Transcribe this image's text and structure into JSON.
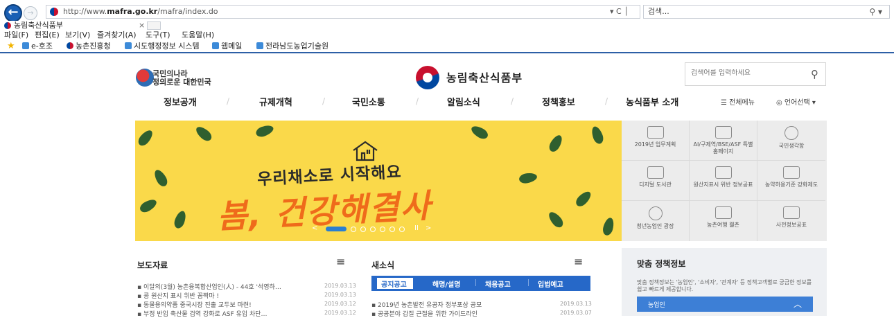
{
  "browser": {
    "back_glyph": "←",
    "forward_glyph": "→",
    "url_prefix": "http://www.",
    "url_domain": "mafra.go.kr",
    "url_path": "/mafra/index.do",
    "url_controls": "▾ C │",
    "search_placeholder": "검색...",
    "search_icon": "⚲ ▾",
    "tab_title": "농림축산식품부",
    "tab_close": "×",
    "menu": [
      "파일(F)",
      "편집(E)",
      "보기(V)",
      "즐겨찾기(A)",
      "도구(T)",
      "도움말(H)"
    ],
    "favorites": [
      "e-호조",
      "농촌진흥청",
      "시도행정정보 시스템",
      "웹메일",
      "전라남도농업기술원"
    ]
  },
  "header": {
    "left_logo_line1": "국민의나라",
    "left_logo_line2": "정의로운 대한민국",
    "ministry": "농림축산식품부",
    "search_placeholder": "검색어를 입력하세요",
    "search_icon_glyph": "⚲"
  },
  "gnb": {
    "items": [
      "정보공개",
      "규제개혁",
      "국민소통",
      "알림소식",
      "정책홍보",
      "농식품부 소개"
    ],
    "all_menu": "☰ 전체메뉴",
    "language": "◎ 언어선택 ▾",
    "sep": "/"
  },
  "banner": {
    "line1": "우리채소로 시작해요",
    "line2": "봄, 건강해결사",
    "dots_prev": "<",
    "dots_pause": "II",
    "dots_next": ">"
  },
  "quick_links": [
    {
      "label": "2019년 업무계획",
      "icon": "chart-icon"
    },
    {
      "label": "AI/구제역/BSE/ASF 특별홈페이지",
      "icon": "monitor-icon"
    },
    {
      "label": "국민생각함",
      "icon": "chat-icon"
    },
    {
      "label": "디지털 도서관",
      "icon": "book-icon"
    },
    {
      "label": "원산지표시 위반 정보공표",
      "icon": "store-icon"
    },
    {
      "label": "농약허용기준 강화제도",
      "icon": "bottle-icon"
    },
    {
      "label": "청년농업인 광장",
      "icon": "satellite-icon"
    },
    {
      "label": "농촌여행 웰촌",
      "icon": "map-icon"
    },
    {
      "label": "사전정보공표",
      "icon": "pen-icon"
    }
  ],
  "press": {
    "title": "보도자료",
    "menu_icon": "≡",
    "items": [
      {
        "text": "이달의(3월) 농촌융복합산업인(人) - 44호 '석영하…",
        "date": "2019.03.13"
      },
      {
        "text": "콩 원산지 표시 위반 꼼짝마 !",
        "date": "2019.03.13"
      },
      {
        "text": "동물용의약품 중국시장 진출 교두보 마련!",
        "date": "2019.03.12"
      },
      {
        "text": "부정 반입 축산물 검역 강화로 ASF 유입 차단…",
        "date": "2019.03.12"
      }
    ]
  },
  "news": {
    "title": "새소식",
    "menu_icon": "≡",
    "tabs": [
      "공지공고",
      "해명/설명",
      "채용공고",
      "입법예고"
    ],
    "items": [
      {
        "text": "2019년 농촌발전 유공자 정부포상 공모",
        "date": "2019.03.13"
      },
      {
        "text": "공공분야 갑질 근절을 위한 가이드라인",
        "date": "2019.03.07"
      }
    ]
  },
  "custom": {
    "title": "맞춤 정책정보",
    "desc": "맞춤 정책정보는 '농업인', '소비자', '관계자' 등 정책고객별로 궁금한 정보를 쉽고 빠르게 제공합니다.",
    "bar_label": "농업인",
    "bar_icon": "︿"
  },
  "colors": {
    "accent": "#2668c8",
    "banner_bg": "#fad94a",
    "banner_headline": "#ef6b1b"
  }
}
